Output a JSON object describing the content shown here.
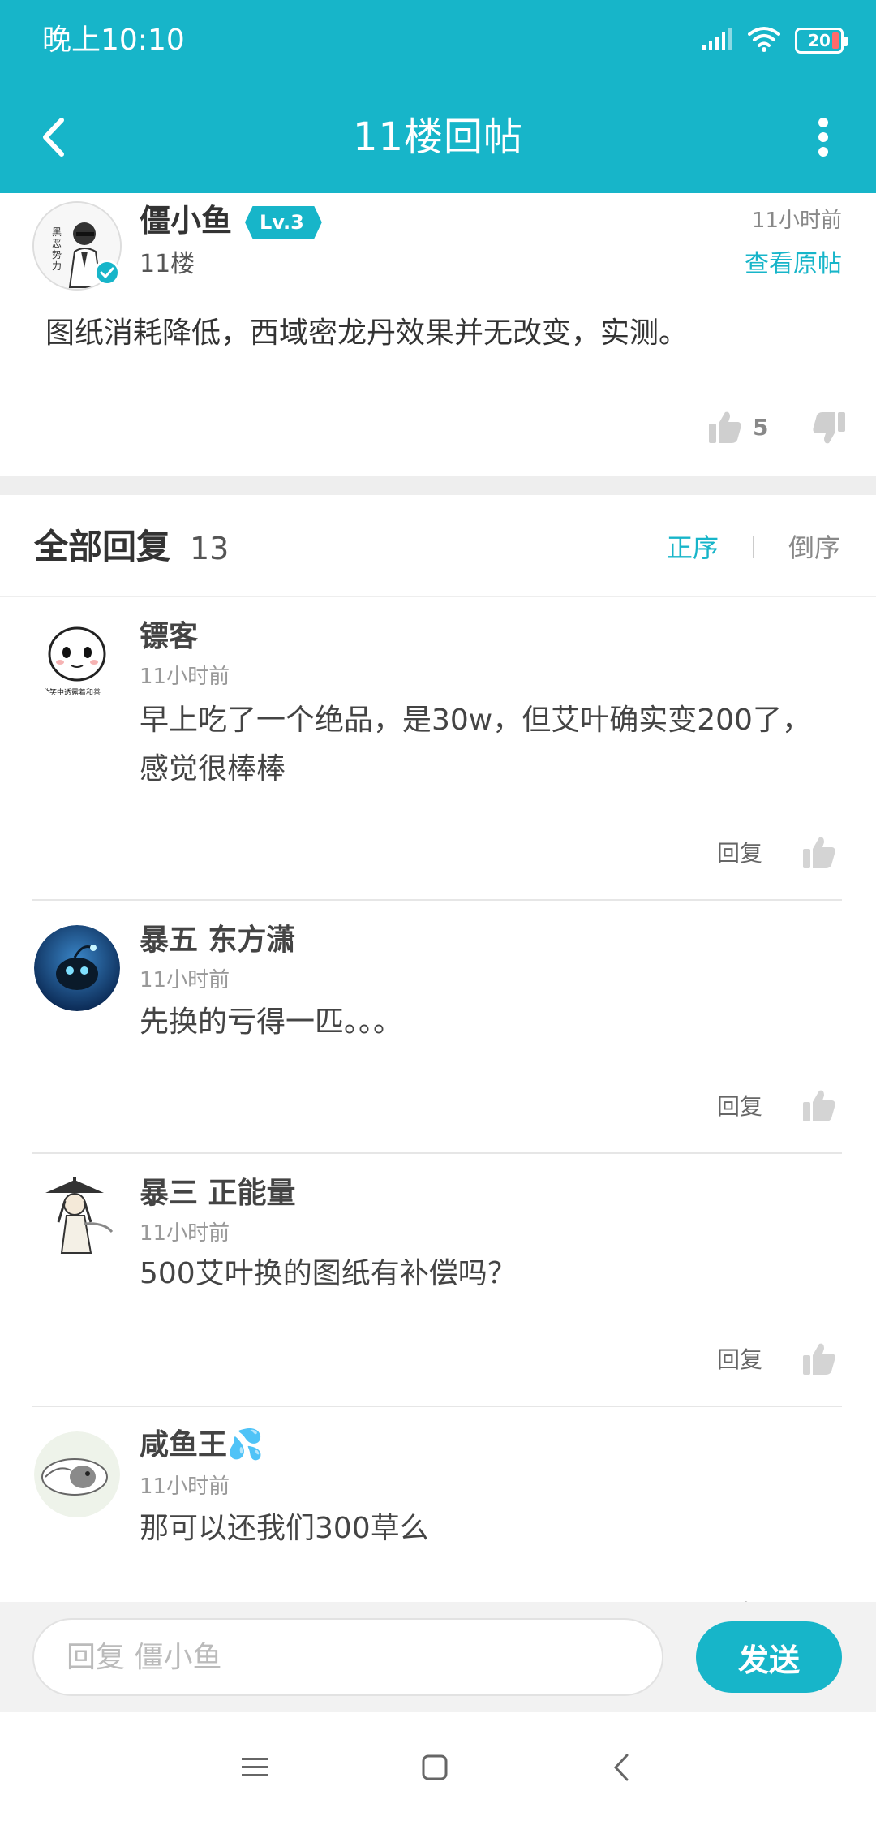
{
  "status_bar": {
    "time": "晚上10:10",
    "battery": "20",
    "icons": [
      "signal-icon",
      "wifi-icon",
      "battery-icon"
    ]
  },
  "header": {
    "title": "11楼回帖",
    "back_icon": "back-arrow-icon",
    "more_icon": "more-vertical-icon"
  },
  "post": {
    "author": "僵小鱼",
    "level": "Lv.3",
    "floor": "11楼",
    "time": "11小时前",
    "view_original": "查看原帖",
    "content": "图纸消耗降低，西域密龙丹效果并无改变，实测。",
    "likes": "5",
    "avatar_icon": "avatar-icon",
    "verified_icon": "verified-check-icon"
  },
  "replies_section": {
    "title": "全部回复",
    "count": "13",
    "sort_asc": "正序",
    "sort_desc": "倒序"
  },
  "replies": [
    {
      "name": "镖客",
      "time": "11小时前",
      "content_lines": [
        "早上吃了一个绝品，是30w，但艾叶确实变200了，",
        "感觉很棒棒"
      ],
      "reply_label": "回复"
    },
    {
      "name": "暴五 东方潇",
      "time": "11小时前",
      "content_lines": [
        "先换的亏得一匹。。。"
      ],
      "reply_label": "回复"
    },
    {
      "name": "暴三 正能量",
      "time": "11小时前",
      "content_lines": [
        "500艾叶换的图纸有补偿吗？"
      ],
      "reply_label": "回复"
    },
    {
      "name": "咸鱼王💦",
      "time": "11小时前",
      "content_lines": [
        "那可以还我们300草么"
      ],
      "reply_label": "回复"
    }
  ],
  "input_bar": {
    "placeholder": "回复 僵小鱼",
    "value": "",
    "send_label": "发送"
  },
  "nav_bar": {
    "icons": [
      "menu-icon",
      "home-square-icon",
      "back-chevron-icon"
    ]
  },
  "colors": {
    "accent": "#17b5c9",
    "text": "#333333",
    "muted": "#999999",
    "divider": "#eeeeee"
  }
}
